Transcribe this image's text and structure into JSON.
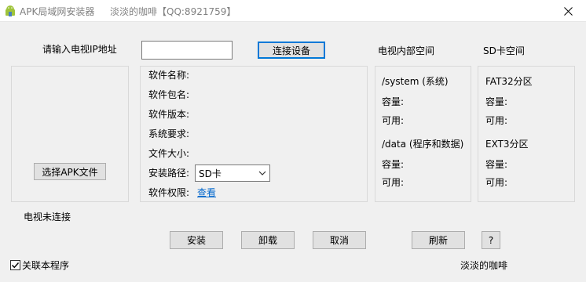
{
  "window": {
    "title": "APK局域网安装器",
    "subtitle": "淡淡的咖啡【QQ:8921759】"
  },
  "connection": {
    "ip_label": "请输入电视IP地址",
    "ip_value": "",
    "connect_button": "连接设备"
  },
  "space_headers": {
    "tv_internal": "电视内部空间",
    "sd_card": "SD卡空间"
  },
  "apk": {
    "select_button": "选择APK文件"
  },
  "info": {
    "name_label": "软件名称:",
    "package_label": "软件包名:",
    "version_label": "软件版本:",
    "requirement_label": "系统要求:",
    "size_label": "文件大小:",
    "install_path_label": "安装路径:",
    "install_path_value": "SD卡",
    "permission_label": "软件权限:",
    "permission_link": "查看"
  },
  "tv_space": {
    "system_title": "/system (系统)",
    "system_capacity_label": "容量:",
    "system_available_label": "可用:",
    "data_title": "/data (程序和数据)",
    "data_capacity_label": "容量:",
    "data_available_label": "可用:"
  },
  "sd_space": {
    "fat32_title": "FAT32分区",
    "fat32_capacity_label": "容量:",
    "fat32_available_label": "可用:",
    "ext3_title": "EXT3分区",
    "ext3_capacity_label": "容量:",
    "ext3_available_label": "可用:"
  },
  "status": {
    "text": "电视未连接"
  },
  "actions": {
    "install": "安装",
    "uninstall": "卸载",
    "cancel": "取消",
    "refresh": "刷新",
    "help": "?"
  },
  "footer": {
    "associate_label": "关联本程序",
    "associate_checked": true,
    "author": "淡淡的咖啡"
  },
  "colors": {
    "link": "#0066cc",
    "focus_border": "#0078d7",
    "window_bg": "#f0f0f0"
  }
}
